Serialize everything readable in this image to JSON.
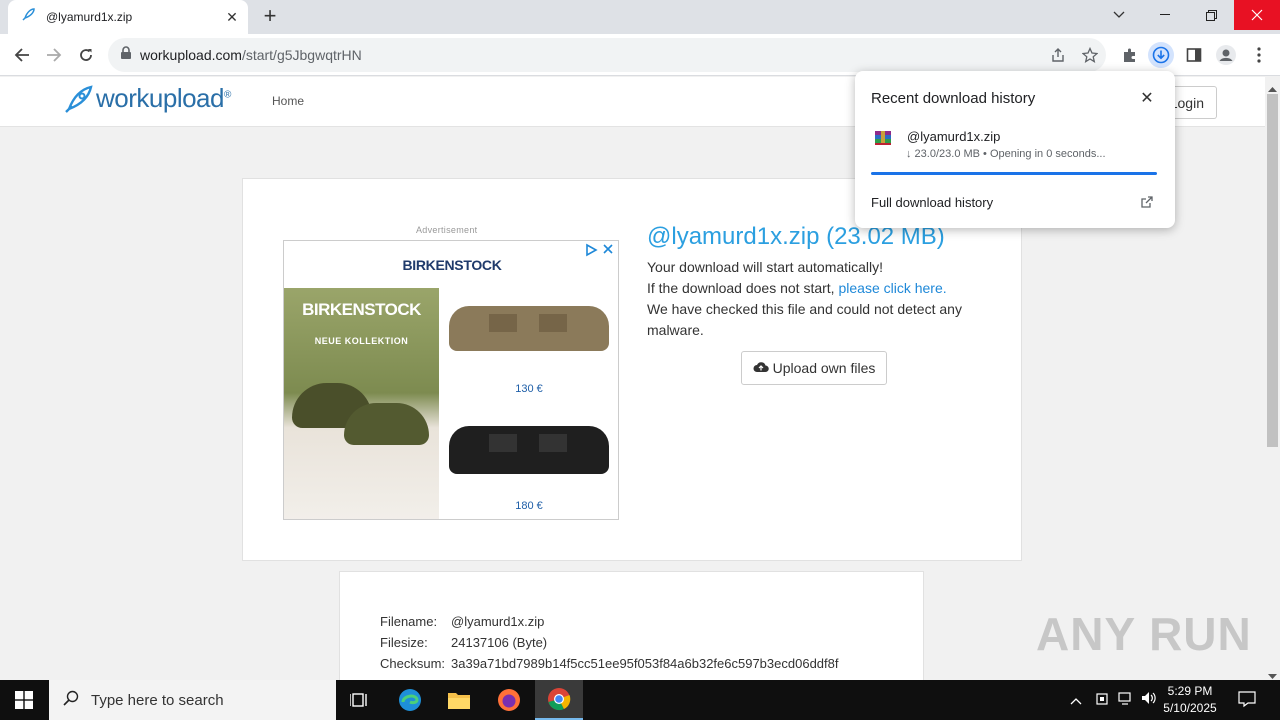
{
  "browser": {
    "tab_title": "@lyamurd1x.zip",
    "url_host": "workupload.com",
    "url_path": "/start/g5JbgwqtrHN"
  },
  "site": {
    "logo_text": "workupload",
    "logo_reg": "®",
    "nav_home": "Home",
    "login_label": "Login",
    "ad_label": "Advertisement",
    "ad": {
      "brand_header": "BIRKENSTOCK",
      "brand_overlay": "BIRKENSTOCK",
      "tagline": "NEUE KOLLEKTION",
      "price1": "130 €",
      "price2": "180 €"
    },
    "file_title": "@lyamurd1x.zip (23.02 MB)",
    "line1": "Your download will start automatically!",
    "line2_prefix": "If the download does not start, ",
    "line2_link": "please click here.",
    "line3": "We have checked this file and could not detect any",
    "line4": "malware.",
    "upload_button": "Upload own files",
    "details": {
      "filename_label": "Filename:",
      "filename_value": "@lyamurd1x.zip",
      "filesize_label": "Filesize:",
      "filesize_value": "24137106 (Byte)",
      "checksum_label": "Checksum:",
      "checksum_value": "3a39a71bd7989b14f5cc51ee95f053f84a6b32fe6c597b3ecd06ddf8f"
    }
  },
  "download_bubble": {
    "title": "Recent download history",
    "file_name": "@lyamurd1x.zip",
    "status": "↓ 23.0/23.0 MB • Opening in 0 seconds...",
    "progress": 1.0,
    "full_history": "Full download history"
  },
  "taskbar": {
    "search_placeholder": "Type here to search",
    "time": "5:29 PM",
    "date": "5/10/2025"
  },
  "watermark": "ANY RUN",
  "colors": {
    "accent_blue": "#1a73e8",
    "site_link": "#2b9fe0",
    "close_red": "#e81123"
  }
}
